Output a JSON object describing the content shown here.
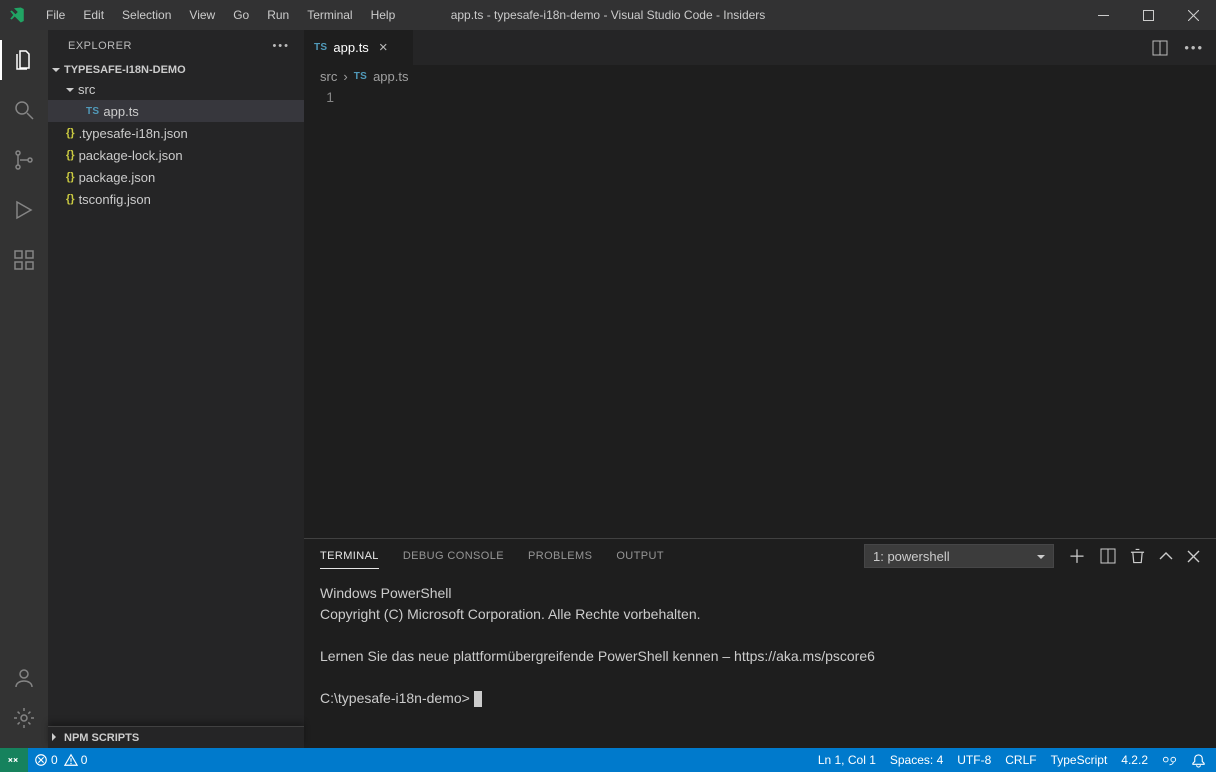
{
  "title": "app.ts - typesafe-i18n-demo - Visual Studio Code - Insiders",
  "menu": {
    "items": [
      "File",
      "Edit",
      "Selection",
      "View",
      "Go",
      "Run",
      "Terminal",
      "Help"
    ]
  },
  "sidebar": {
    "header": "EXPLORER",
    "project": "TYPESAFE-I18N-DEMO",
    "folder": "src",
    "files": [
      {
        "icon": "TS",
        "label": "app.ts",
        "active": true,
        "iconClass": "ts-icon"
      },
      {
        "icon": "{}",
        "label": ".typesafe-i18n.json",
        "iconClass": "js-icon"
      },
      {
        "icon": "{}",
        "label": "package-lock.json",
        "iconClass": "js-icon"
      },
      {
        "icon": "{}",
        "label": "package.json",
        "iconClass": "js-icon"
      },
      {
        "icon": "{}",
        "label": "tsconfig.json",
        "iconClass": "js-icon"
      }
    ],
    "npm_scripts": "NPM SCRIPTS"
  },
  "tab": {
    "icon": "TS",
    "label": "app.ts"
  },
  "breadcrumb": {
    "folder": "src",
    "sep": "›",
    "icon": "TS",
    "file": "app.ts"
  },
  "editor": {
    "line": "1"
  },
  "panel": {
    "tabs": [
      "TERMINAL",
      "DEBUG CONSOLE",
      "PROBLEMS",
      "OUTPUT"
    ],
    "shell": "1: powershell",
    "lines": {
      "l1": "Windows PowerShell",
      "l2": "Copyright (C) Microsoft Corporation. Alle Rechte vorbehalten.",
      "l3": "Lernen Sie das neue plattformübergreifende PowerShell kennen – https://aka.ms/pscore6",
      "l4": "C:\\typesafe-i18n-demo>"
    }
  },
  "status": {
    "errors": "0",
    "warnings": "0",
    "pos": "Ln 1, Col 1",
    "spaces": "Spaces: 4",
    "enc": "UTF-8",
    "eol": "CRLF",
    "lang": "TypeScript",
    "tsver": "4.2.2"
  }
}
